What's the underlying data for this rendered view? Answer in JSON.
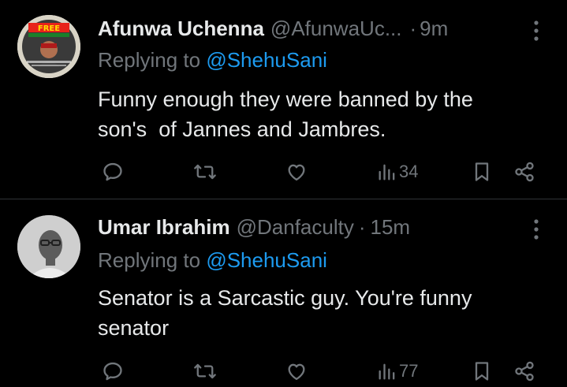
{
  "tweets": [
    {
      "author_name": "Afunwa Uchenna",
      "handle": "@AfunwaUc...",
      "separator": "·",
      "time": "9m",
      "replying_prefix": "Replying to ",
      "replying_to": "@ShehuSani",
      "body_lines": [
        "Funny enough they were banned by the",
        "son's  of Jannes and Jambres."
      ],
      "views": "34",
      "avatar_text": "FREE"
    },
    {
      "author_name": "Umar Ibrahim",
      "handle": "@Danfaculty",
      "separator": "·",
      "time": "15m",
      "replying_prefix": "Replying to ",
      "replying_to": "@ShehuSani",
      "body_lines": [
        "Senator is a Sarcastic guy. You're funny",
        "senator"
      ],
      "views": "77"
    }
  ],
  "icons": {
    "reply": "reply-icon",
    "retweet": "retweet-icon",
    "like": "heart-icon",
    "views": "views-icon",
    "bookmark": "bookmark-icon",
    "share": "share-icon",
    "more": "more-icon"
  },
  "colors": {
    "background": "#000000",
    "text": "#e7e9ea",
    "muted": "#71767b",
    "mention": "#1d9bf0",
    "divider": "#2f3336"
  }
}
